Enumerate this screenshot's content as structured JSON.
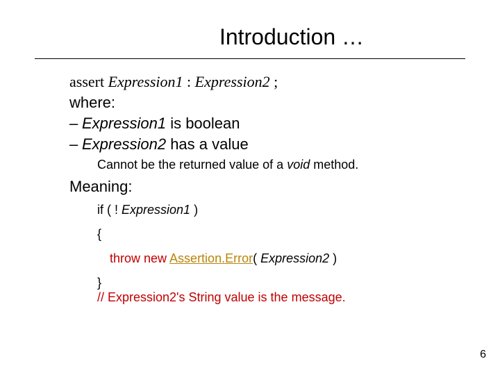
{
  "slide": {
    "title": "Introduction …",
    "assert_kw": "assert",
    "assert_e1": "Expression1",
    "assert_sep": " : ",
    "assert_e2": "Expression2",
    "assert_end": " ;",
    "where": "where:",
    "b1_dash": "–  ",
    "b1_e": "Expression1",
    "b1_rest": " is boolean",
    "b2_dash": "–  ",
    "b2_e": "Expression2",
    "b2_rest": " has a value",
    "sub_pre": "Cannot be the returned value of  a ",
    "sub_void": "void",
    "sub_post": " method.",
    "meaning": "Meaning:",
    "if_pre": "if ( ! ",
    "if_e": "Expression1",
    "if_post": " )",
    "open_brace": "{",
    "throw_pre": "throw new ",
    "throw_link": "Assertion.Error",
    "throw_mid": "( ",
    "throw_e": "Expression2",
    "throw_post": " )",
    "close_brace": "}",
    "comment": "// Expression2's String value is the message.",
    "page": "6"
  }
}
